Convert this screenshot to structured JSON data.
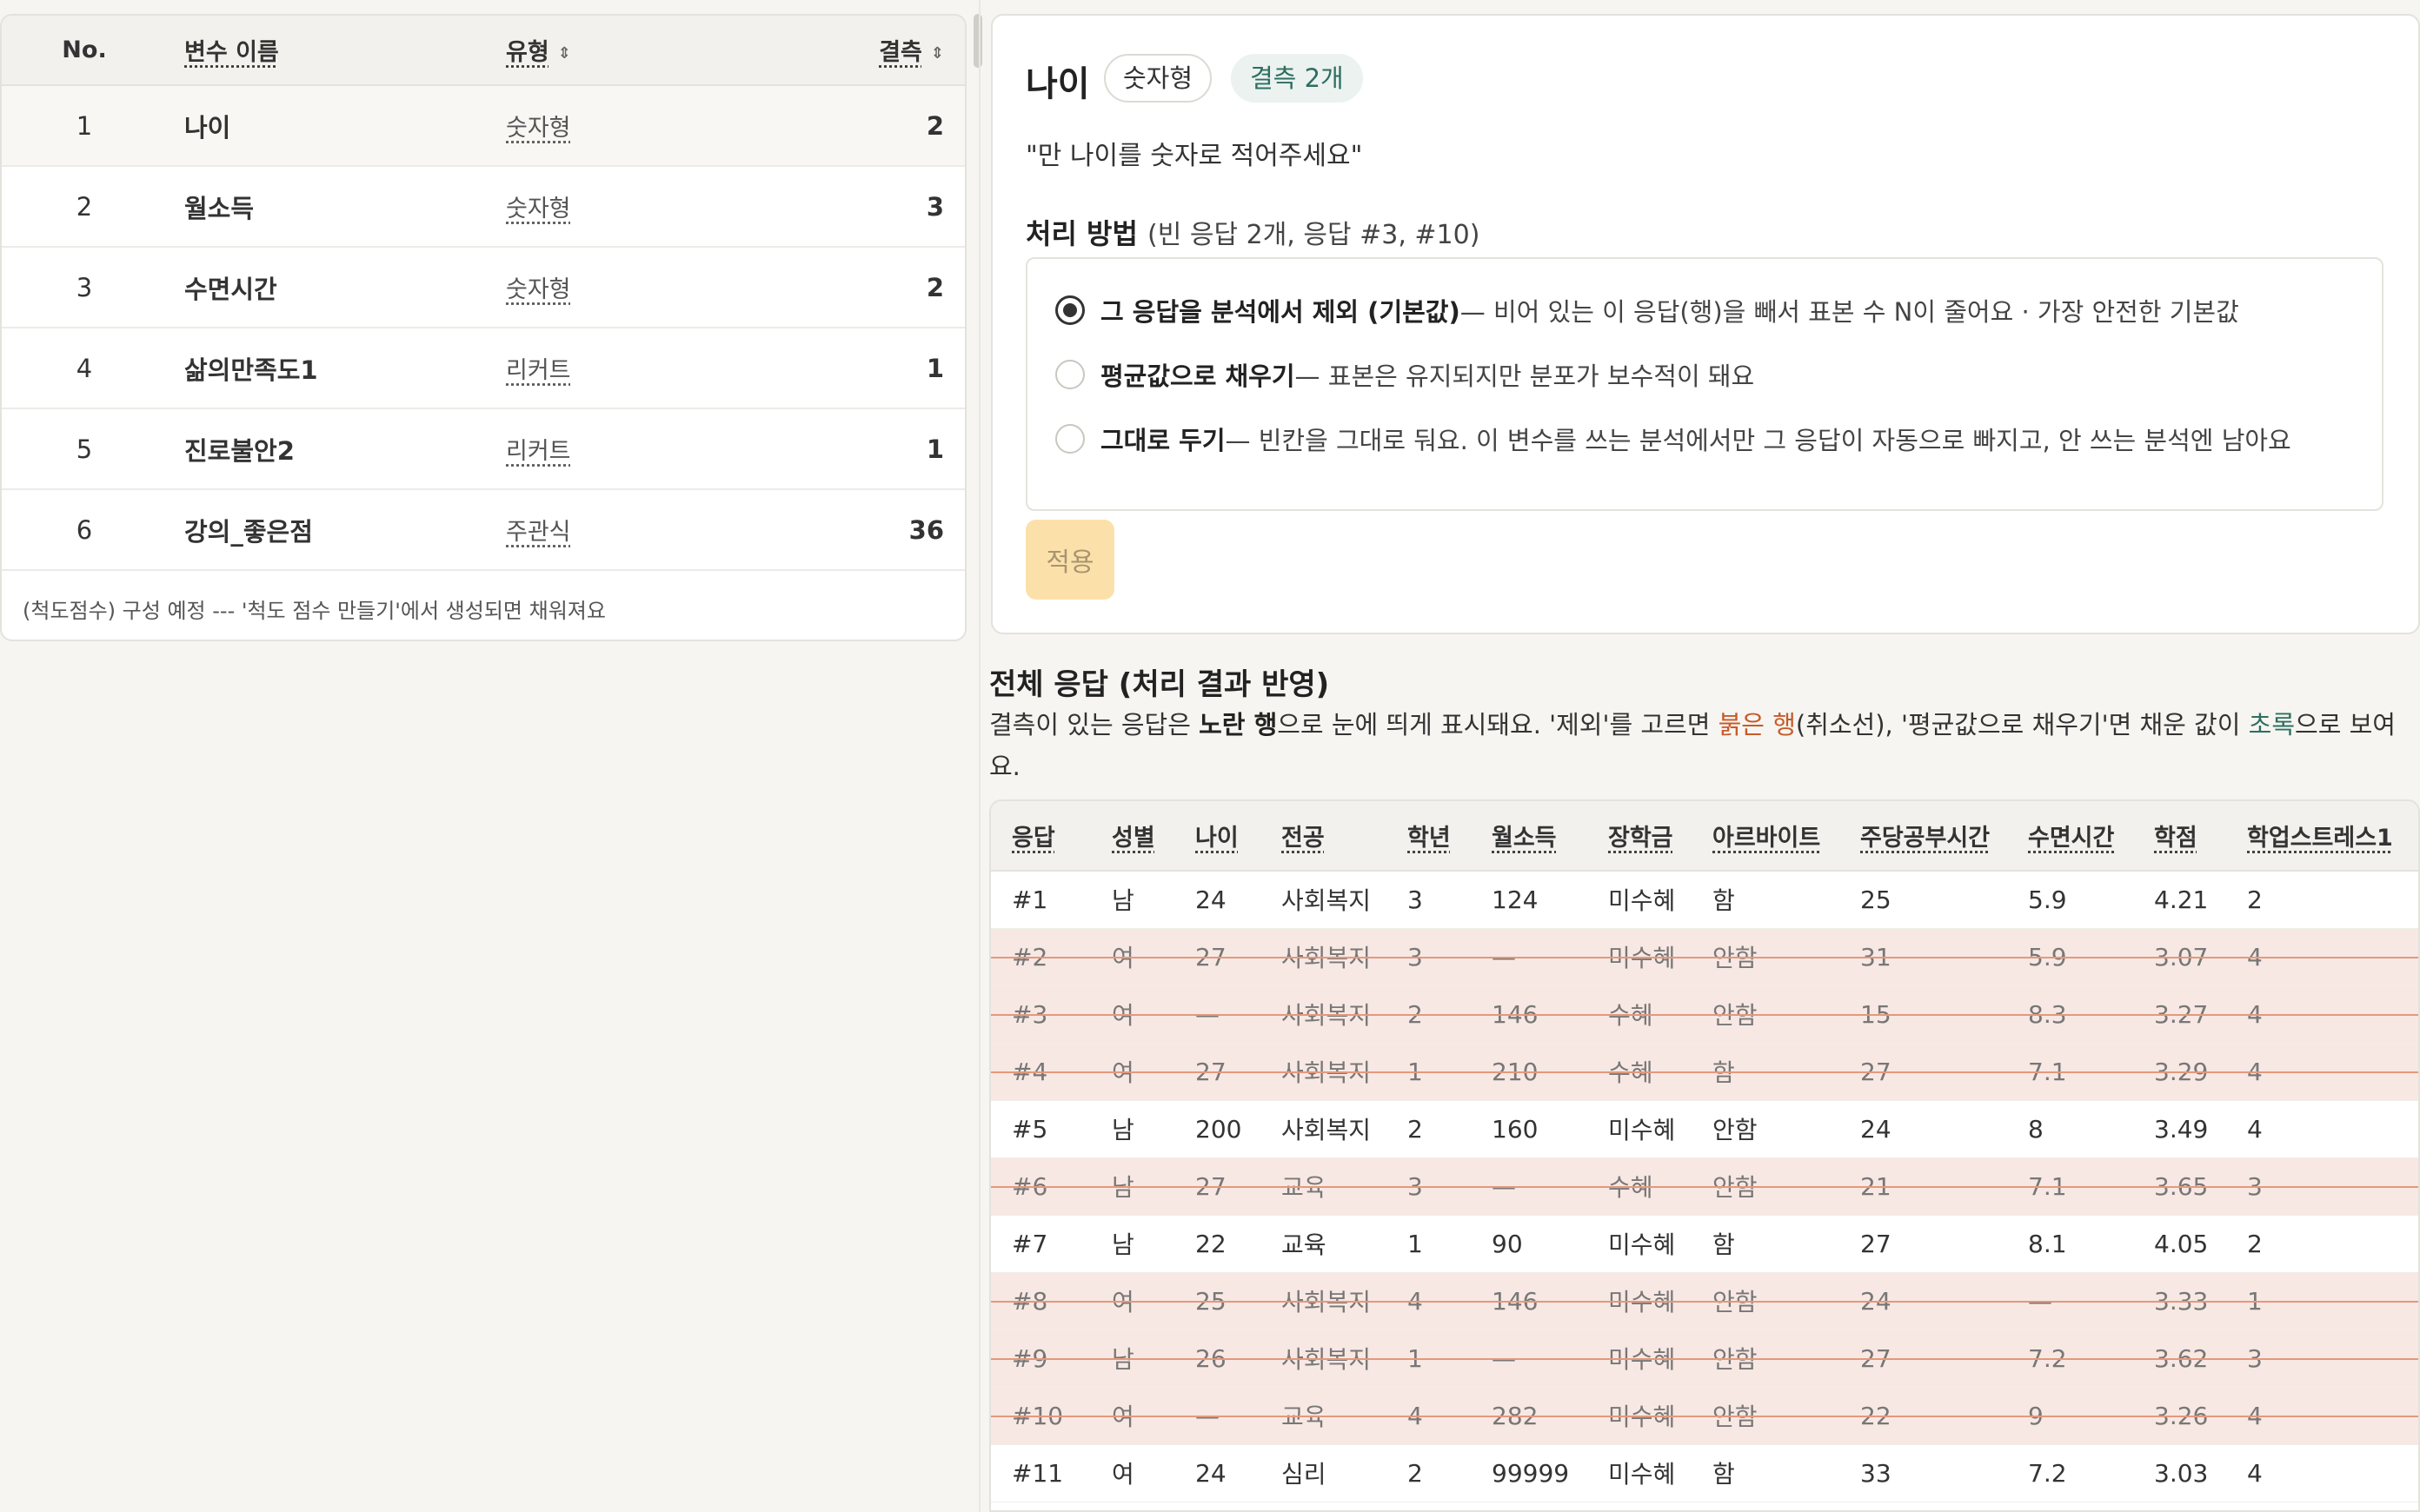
{
  "variables": {
    "columns": {
      "no": "No.",
      "name": "변수 이름",
      "type": "유형",
      "missing": "결측"
    },
    "rows": [
      {
        "no": "1",
        "name": "나이",
        "type": "숫자형",
        "missing": "2"
      },
      {
        "no": "2",
        "name": "월소득",
        "type": "숫자형",
        "missing": "3"
      },
      {
        "no": "3",
        "name": "수면시간",
        "type": "숫자형",
        "missing": "2"
      },
      {
        "no": "4",
        "name": "삶의만족도1",
        "type": "리커트",
        "missing": "1"
      },
      {
        "no": "5",
        "name": "진로불안2",
        "type": "리커트",
        "missing": "1"
      },
      {
        "no": "6",
        "name": "강의_좋은점",
        "type": "주관식",
        "missing": "36"
      }
    ],
    "note": "(척도점수) 구성 예정 --- '척도 점수 만들기'에서 생성되면 채워져요"
  },
  "detail": {
    "title": "나이",
    "type_chip": "숫자형",
    "missing_chip": "결측 2개",
    "question": "\"만 나이를 숫자로 적어주세요\"",
    "method_heading": "처리 방법",
    "method_sub": "(빈 응답 2개, 응답 #3, #10)",
    "options": [
      {
        "title": "그 응답을 분석에서 제외 (기본값)",
        "desc": " — 비어 있는 이 응답(행)을 빼서 표본 수 N이 줄어요 · 가장 안전한 기본값",
        "selected": true
      },
      {
        "title": "평균값으로 채우기",
        "desc": " — 표본은 유지되지만 분포가 보수적이 돼요",
        "selected": false
      },
      {
        "title": "그대로 두기",
        "desc": " — 빈칸을 그대로 둬요. 이 변수를 쓰는 분석에서만 그 응답이 자동으로 빠지고, 안 쓰는 분석엔 남아요",
        "selected": false
      }
    ],
    "apply_label": "적용"
  },
  "responses": {
    "title": "전체 응답 (처리 결과 반영)",
    "desc": {
      "p1": "결측이 있는 응답은 ",
      "b1": "노란 행",
      "p2": "으로 눈에 띄게 표시돼요. '제외'를 고르면 ",
      "red": "붉은 행",
      "p3": "(취소선), '평균값으로 채우기'면 채운 값이 ",
      "green": "초록",
      "p4": "으로 보여요."
    },
    "columns": [
      "응답",
      "성별",
      "나이",
      "전공",
      "학년",
      "월소득",
      "장학금",
      "아르바이트",
      "주당공부시간",
      "수면시간",
      "학점",
      "학업스트레스1"
    ],
    "rows": [
      {
        "excluded": false,
        "cells": [
          "#1",
          "남",
          "24",
          "사회복지",
          "3",
          "124",
          "미수혜",
          "함",
          "25",
          "5.9",
          "4.21",
          "2"
        ]
      },
      {
        "excluded": true,
        "cells": [
          "#2",
          "여",
          "27",
          "사회복지",
          "3",
          "—",
          "미수혜",
          "안함",
          "31",
          "5.9",
          "3.07",
          "4"
        ]
      },
      {
        "excluded": true,
        "cells": [
          "#3",
          "여",
          "—",
          "사회복지",
          "2",
          "146",
          "수혜",
          "안함",
          "15",
          "8.3",
          "3.27",
          "4"
        ]
      },
      {
        "excluded": true,
        "cells": [
          "#4",
          "여",
          "27",
          "사회복지",
          "1",
          "210",
          "수혜",
          "함",
          "27",
          "7.1",
          "3.29",
          "4"
        ]
      },
      {
        "excluded": false,
        "cells": [
          "#5",
          "남",
          "200",
          "사회복지",
          "2",
          "160",
          "미수혜",
          "안함",
          "24",
          "8",
          "3.49",
          "4"
        ]
      },
      {
        "excluded": true,
        "cells": [
          "#6",
          "남",
          "27",
          "교육",
          "3",
          "—",
          "수혜",
          "안함",
          "21",
          "7.1",
          "3.65",
          "3"
        ]
      },
      {
        "excluded": false,
        "cells": [
          "#7",
          "남",
          "22",
          "교육",
          "1",
          "90",
          "미수혜",
          "함",
          "27",
          "8.1",
          "4.05",
          "2"
        ]
      },
      {
        "excluded": true,
        "cells": [
          "#8",
          "여",
          "25",
          "사회복지",
          "4",
          "146",
          "미수혜",
          "안함",
          "24",
          "—",
          "3.33",
          "1"
        ]
      },
      {
        "excluded": true,
        "cells": [
          "#9",
          "남",
          "26",
          "사회복지",
          "1",
          "—",
          "미수혜",
          "안함",
          "27",
          "7.2",
          "3.62",
          "3"
        ]
      },
      {
        "excluded": true,
        "cells": [
          "#10",
          "여",
          "—",
          "교육",
          "4",
          "282",
          "미수혜",
          "안함",
          "22",
          "9",
          "3.26",
          "4"
        ]
      },
      {
        "excluded": false,
        "cells": [
          "#11",
          "여",
          "24",
          "심리",
          "2",
          "99999",
          "미수혜",
          "함",
          "33",
          "7.2",
          "3.03",
          "4"
        ]
      }
    ]
  },
  "colors": {
    "accent_green": "#2e6e61",
    "excluded_row_bg": "#f8e8e3",
    "strike_line": "#e3997c",
    "apply_button_bg": "#fbe1a9",
    "red_text": "#c85a2a"
  }
}
